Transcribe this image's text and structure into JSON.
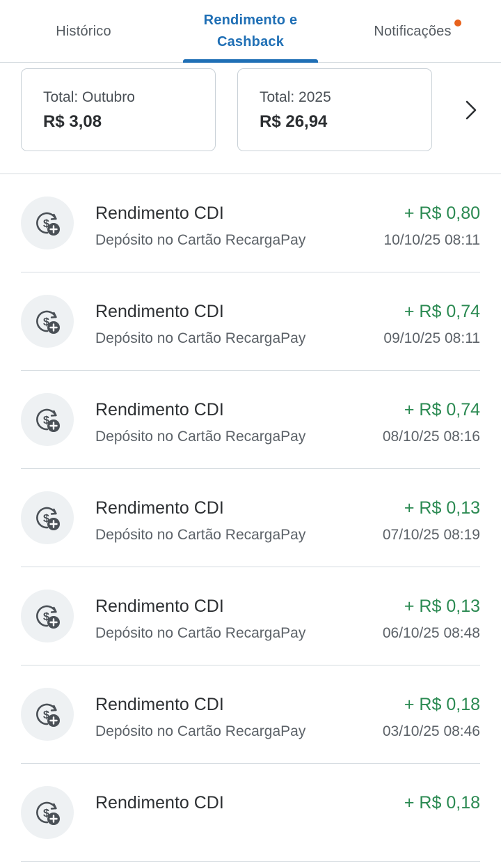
{
  "tabs": [
    {
      "label": "Histórico",
      "active": false
    },
    {
      "label": "Rendimento e Cashback",
      "active": true
    },
    {
      "label": "Notificações",
      "active": false,
      "has_badge": true
    }
  ],
  "colors": {
    "accent": "#1f6fb5",
    "positive": "#2b8a52",
    "badge": "#e8621c"
  },
  "summary": {
    "cards": [
      {
        "label": "Total: Outubro",
        "value": "R$ 3,08"
      },
      {
        "label": "Total: 2025",
        "value": "R$ 26,94"
      }
    ],
    "next_icon": "chevron-right-icon"
  },
  "transactions": [
    {
      "title": "Rendimento CDI",
      "subtitle": "Depósito no Cartão RecargaPay",
      "amount": "+ R$ 0,80",
      "date": "10/10/25 08:11",
      "icon": "coin-plus-icon"
    },
    {
      "title": "Rendimento CDI",
      "subtitle": "Depósito no Cartão RecargaPay",
      "amount": "+ R$ 0,74",
      "date": "09/10/25 08:11",
      "icon": "coin-plus-icon"
    },
    {
      "title": "Rendimento CDI",
      "subtitle": "Depósito no Cartão RecargaPay",
      "amount": "+ R$ 0,74",
      "date": "08/10/25 08:16",
      "icon": "coin-plus-icon"
    },
    {
      "title": "Rendimento CDI",
      "subtitle": "Depósito no Cartão RecargaPay",
      "amount": "+ R$ 0,13",
      "date": "07/10/25 08:19",
      "icon": "coin-plus-icon"
    },
    {
      "title": "Rendimento CDI",
      "subtitle": "Depósito no Cartão RecargaPay",
      "amount": "+ R$ 0,13",
      "date": "06/10/25 08:48",
      "icon": "coin-plus-icon"
    },
    {
      "title": "Rendimento CDI",
      "subtitle": "Depósito no Cartão RecargaPay",
      "amount": "+ R$ 0,18",
      "date": "03/10/25 08:46",
      "icon": "coin-plus-icon"
    },
    {
      "title": "Rendimento CDI",
      "subtitle": "",
      "amount": "+ R$ 0,18",
      "date": "",
      "icon": "coin-plus-icon"
    }
  ]
}
